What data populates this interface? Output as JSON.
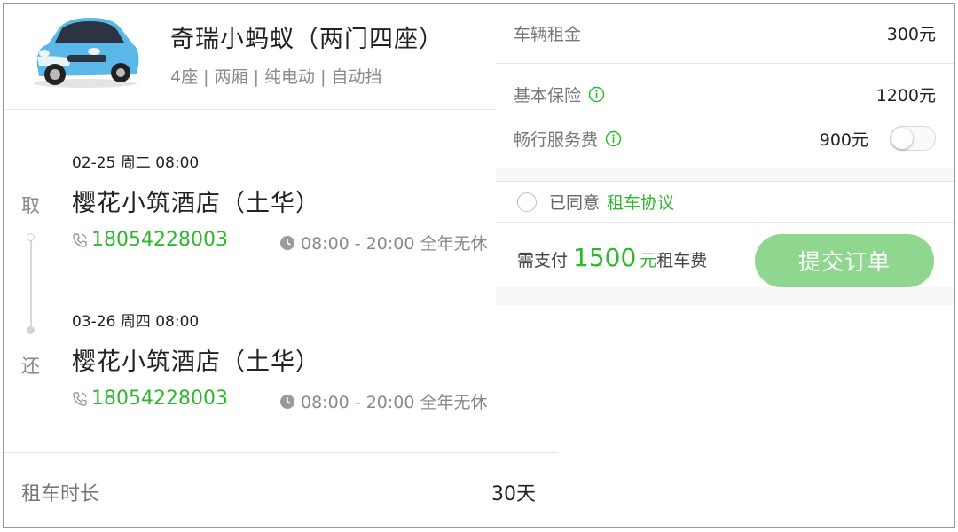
{
  "car": {
    "name": "奇瑞小蚂蚁（两门四座）",
    "specs": "4座 | 两厢 | 纯电动 | 自动挡",
    "body_color": "#5ab8e8"
  },
  "pickup": {
    "tag": "取",
    "datetime": "02-25  周二 08:00",
    "store": "樱花小筑酒店（土华）",
    "phone": "18054228003",
    "hours": "08:00 - 20:00 全年无休"
  },
  "return": {
    "tag": "还",
    "datetime": "03-26  周四 08:00",
    "store": "樱花小筑酒店（土华）",
    "phone": "18054228003",
    "hours": "08:00 - 20:00 全年无休"
  },
  "duration": {
    "label": "租车时长",
    "value": "30天"
  },
  "fees": {
    "rent_label": "车辆租金",
    "rent_value": "300元",
    "insurance_label": "基本保险",
    "insurance_value": "1200元",
    "service_label": "畅行服务费",
    "service_value": "900元",
    "service_enabled": false
  },
  "agreement": {
    "prefix": "已同意",
    "link": "租车协议",
    "checked": false
  },
  "payment": {
    "prefix": "需支付",
    "amount": "1500",
    "unit": "元",
    "suffix": "租车费"
  },
  "submit_label": "提交订单",
  "colors": {
    "accent": "#2eb82e",
    "button": "#8fd68f",
    "muted": "#8a8a8a"
  }
}
